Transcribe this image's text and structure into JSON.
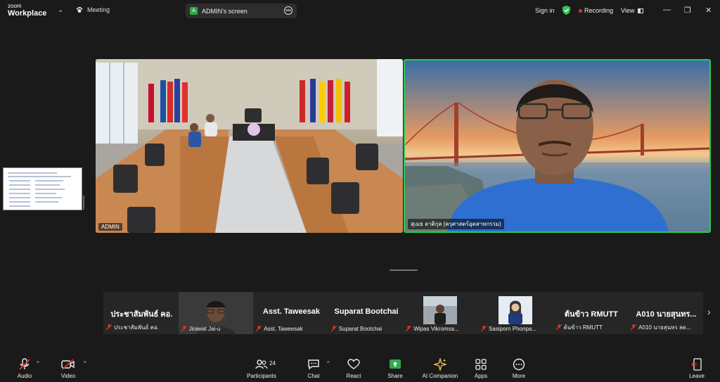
{
  "topbar": {
    "logo_line1": "zoom",
    "logo_line2": "Workplace",
    "meeting_label": "Meeting",
    "screen_share_label": "ADMIN's screen",
    "sign_in": "Sign in",
    "recording": "Recording",
    "view": "View"
  },
  "tiles": {
    "admin_label": "ADMIN",
    "speaker_label": "สุเมธ ลาติกุล (ครุศาสตร์อุตสาหกรรม)"
  },
  "gallery": {
    "participants": [
      {
        "display": "ประชาสัมพันธ์ คอ.",
        "label": "ประชาสัมพันธ์ คอ.",
        "has_video": false
      },
      {
        "display": "",
        "label": "Jirawat Jai-u",
        "has_video": true
      },
      {
        "display": "Asst. Taweesak",
        "label": "Asst. Taweesak",
        "has_video": false
      },
      {
        "display": "Suparat Bootchai",
        "label": "Suparat Bootchai",
        "has_video": false
      },
      {
        "display": "",
        "label": "Wipas Vikromsa...",
        "has_video": true
      },
      {
        "display": "",
        "label": "Sasiporn Phonpa...",
        "has_video": true
      },
      {
        "display": "ต้นข้าว RMUTT",
        "label": "ต้นข้าว RMUTT",
        "has_video": false
      },
      {
        "display": "A010 นายสุนทร...",
        "label": "A010 นายสุนหร ลด...",
        "has_video": false
      }
    ]
  },
  "toolbar": {
    "audio": "Audio",
    "video": "Video",
    "participants": "Participants",
    "participants_count": "24",
    "chat": "Chat",
    "react": "React",
    "share": "Share",
    "ai_companion": "AI Companion",
    "apps": "Apps",
    "more": "More",
    "leave": "Leave"
  },
  "colors": {
    "background": "#1a1a1a",
    "active_speaker_border": "#2dc653",
    "share_green": "#2fa84f",
    "recording_red": "#e5312b",
    "mute_red": "#e5312b"
  }
}
